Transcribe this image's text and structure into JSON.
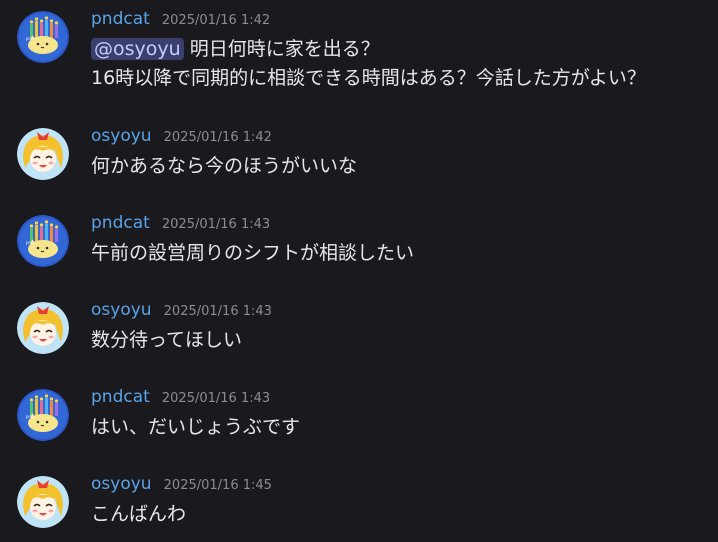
{
  "messages": [
    {
      "author": "pndcat",
      "avatar": "pndcat-avatar",
      "time": "2025/01/16 1:42",
      "mention": "@osyoyu",
      "line1": "明日何時に家を出る？",
      "line2": "16時以降で同期的に相談できる時間はある？今話した方がよい？"
    },
    {
      "author": "osyoyu",
      "avatar": "osyoyu-avatar",
      "time": "2025/01/16 1:42",
      "text": "何かあるなら今のほうがいいな"
    },
    {
      "author": "pndcat",
      "avatar": "pndcat-avatar",
      "time": "2025/01/16 1:43",
      "text": "午前の設営周りのシフトが相談したい"
    },
    {
      "author": "osyoyu",
      "avatar": "osyoyu-avatar",
      "time": "2025/01/16 1:43",
      "text": "数分待ってほしい"
    },
    {
      "author": "pndcat",
      "avatar": "pndcat-avatar",
      "time": "2025/01/16 1:43",
      "text": "はい、だいじょうぶです"
    },
    {
      "author": "osyoyu",
      "avatar": "osyoyu-avatar",
      "time": "2025/01/16 1:45",
      "text": "こんばんわ"
    }
  ],
  "colors": {
    "background": "#1a1a1e",
    "username": "#5aa2e6",
    "timestamp": "#8a8d93",
    "text": "#e6e7ea",
    "mention_bg": "#3b3f6d",
    "mention_text": "#c7cdfa"
  }
}
